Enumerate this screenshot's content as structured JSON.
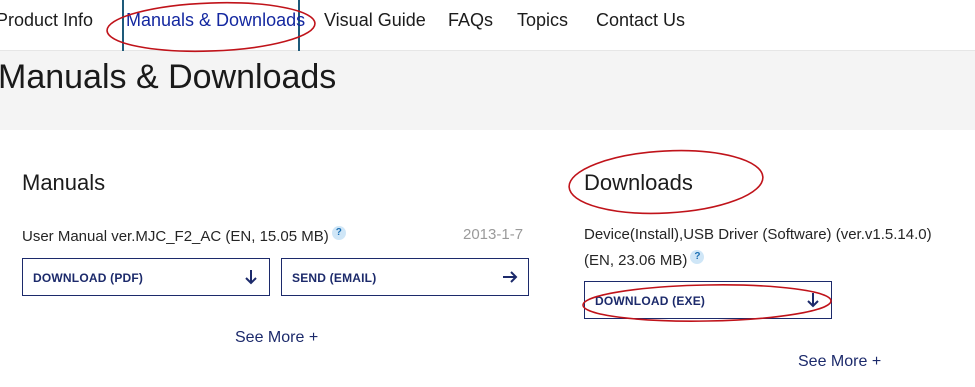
{
  "nav": {
    "items": [
      {
        "label": "Product Info",
        "active": false
      },
      {
        "label": "Manuals & Downloads",
        "active": true
      },
      {
        "label": "Visual Guide",
        "active": false
      },
      {
        "label": "FAQs",
        "active": false
      },
      {
        "label": "Topics",
        "active": false
      },
      {
        "label": "Contact Us",
        "active": false
      }
    ]
  },
  "page_title": "Manuals & Downloads",
  "manuals": {
    "title": "Manuals",
    "file_name": "User Manual ver.MJC_F2_AC (EN, 15.05 MB)",
    "date": "2013-1-7",
    "download_label": "DOWNLOAD (PDF)",
    "send_label": "SEND (EMAIL)",
    "see_more": "See More +"
  },
  "downloads": {
    "title": "Downloads",
    "file_name_line1": "Device(Install),USB Driver (Software) (ver.v1.5.14.0)",
    "file_name_line2": "(EN, 23.06 MB)",
    "download_label": "DOWNLOAD (EXE)",
    "see_more": "See More +"
  },
  "icons": {
    "info": "info-icon",
    "download": "arrow-down-icon",
    "send": "arrow-right-icon"
  },
  "colors": {
    "active_nav": "#1428a0",
    "button_border": "#1c2a6b",
    "annotation": "#c0131a",
    "hero_bg": "#f4f4f4"
  }
}
